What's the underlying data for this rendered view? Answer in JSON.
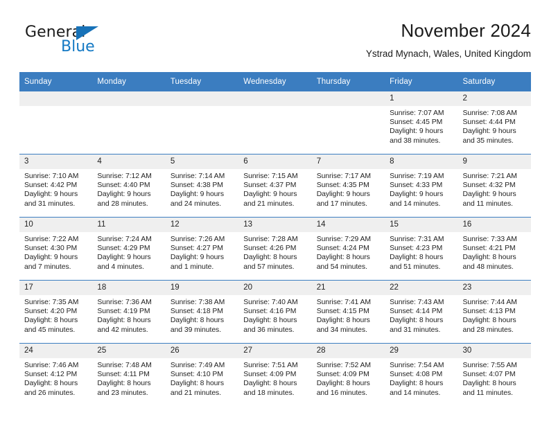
{
  "brand": {
    "name_part1": "General",
    "name_part2": "Blue",
    "accent_color": "#1479c4",
    "triangle_color": "#1772b8"
  },
  "header": {
    "title": "November 2024",
    "location": "Ystrad Mynach, Wales, United Kingdom"
  },
  "calendar": {
    "header_bg": "#3b7dc0",
    "date_band_bg": "#efefef",
    "weekdays": [
      "Sunday",
      "Monday",
      "Tuesday",
      "Wednesday",
      "Thursday",
      "Friday",
      "Saturday"
    ],
    "weeks": [
      [
        {
          "day": "",
          "empty": true,
          "lines": [
            "",
            "",
            "",
            ""
          ]
        },
        {
          "day": "",
          "empty": true,
          "lines": [
            "",
            "",
            "",
            ""
          ]
        },
        {
          "day": "",
          "empty": true,
          "lines": [
            "",
            "",
            "",
            ""
          ]
        },
        {
          "day": "",
          "empty": true,
          "lines": [
            "",
            "",
            "",
            ""
          ]
        },
        {
          "day": "",
          "empty": true,
          "lines": [
            "",
            "",
            "",
            ""
          ]
        },
        {
          "day": "1",
          "empty": false,
          "lines": [
            "Sunrise: 7:07 AM",
            "Sunset: 4:45 PM",
            "Daylight: 9 hours",
            "and 38 minutes."
          ]
        },
        {
          "day": "2",
          "empty": false,
          "lines": [
            "Sunrise: 7:08 AM",
            "Sunset: 4:44 PM",
            "Daylight: 9 hours",
            "and 35 minutes."
          ]
        }
      ],
      [
        {
          "day": "3",
          "empty": false,
          "lines": [
            "Sunrise: 7:10 AM",
            "Sunset: 4:42 PM",
            "Daylight: 9 hours",
            "and 31 minutes."
          ]
        },
        {
          "day": "4",
          "empty": false,
          "lines": [
            "Sunrise: 7:12 AM",
            "Sunset: 4:40 PM",
            "Daylight: 9 hours",
            "and 28 minutes."
          ]
        },
        {
          "day": "5",
          "empty": false,
          "lines": [
            "Sunrise: 7:14 AM",
            "Sunset: 4:38 PM",
            "Daylight: 9 hours",
            "and 24 minutes."
          ]
        },
        {
          "day": "6",
          "empty": false,
          "lines": [
            "Sunrise: 7:15 AM",
            "Sunset: 4:37 PM",
            "Daylight: 9 hours",
            "and 21 minutes."
          ]
        },
        {
          "day": "7",
          "empty": false,
          "lines": [
            "Sunrise: 7:17 AM",
            "Sunset: 4:35 PM",
            "Daylight: 9 hours",
            "and 17 minutes."
          ]
        },
        {
          "day": "8",
          "empty": false,
          "lines": [
            "Sunrise: 7:19 AM",
            "Sunset: 4:33 PM",
            "Daylight: 9 hours",
            "and 14 minutes."
          ]
        },
        {
          "day": "9",
          "empty": false,
          "lines": [
            "Sunrise: 7:21 AM",
            "Sunset: 4:32 PM",
            "Daylight: 9 hours",
            "and 11 minutes."
          ]
        }
      ],
      [
        {
          "day": "10",
          "empty": false,
          "lines": [
            "Sunrise: 7:22 AM",
            "Sunset: 4:30 PM",
            "Daylight: 9 hours",
            "and 7 minutes."
          ]
        },
        {
          "day": "11",
          "empty": false,
          "lines": [
            "Sunrise: 7:24 AM",
            "Sunset: 4:29 PM",
            "Daylight: 9 hours",
            "and 4 minutes."
          ]
        },
        {
          "day": "12",
          "empty": false,
          "lines": [
            "Sunrise: 7:26 AM",
            "Sunset: 4:27 PM",
            "Daylight: 9 hours",
            "and 1 minute."
          ]
        },
        {
          "day": "13",
          "empty": false,
          "lines": [
            "Sunrise: 7:28 AM",
            "Sunset: 4:26 PM",
            "Daylight: 8 hours",
            "and 57 minutes."
          ]
        },
        {
          "day": "14",
          "empty": false,
          "lines": [
            "Sunrise: 7:29 AM",
            "Sunset: 4:24 PM",
            "Daylight: 8 hours",
            "and 54 minutes."
          ]
        },
        {
          "day": "15",
          "empty": false,
          "lines": [
            "Sunrise: 7:31 AM",
            "Sunset: 4:23 PM",
            "Daylight: 8 hours",
            "and 51 minutes."
          ]
        },
        {
          "day": "16",
          "empty": false,
          "lines": [
            "Sunrise: 7:33 AM",
            "Sunset: 4:21 PM",
            "Daylight: 8 hours",
            "and 48 minutes."
          ]
        }
      ],
      [
        {
          "day": "17",
          "empty": false,
          "lines": [
            "Sunrise: 7:35 AM",
            "Sunset: 4:20 PM",
            "Daylight: 8 hours",
            "and 45 minutes."
          ]
        },
        {
          "day": "18",
          "empty": false,
          "lines": [
            "Sunrise: 7:36 AM",
            "Sunset: 4:19 PM",
            "Daylight: 8 hours",
            "and 42 minutes."
          ]
        },
        {
          "day": "19",
          "empty": false,
          "lines": [
            "Sunrise: 7:38 AM",
            "Sunset: 4:18 PM",
            "Daylight: 8 hours",
            "and 39 minutes."
          ]
        },
        {
          "day": "20",
          "empty": false,
          "lines": [
            "Sunrise: 7:40 AM",
            "Sunset: 4:16 PM",
            "Daylight: 8 hours",
            "and 36 minutes."
          ]
        },
        {
          "day": "21",
          "empty": false,
          "lines": [
            "Sunrise: 7:41 AM",
            "Sunset: 4:15 PM",
            "Daylight: 8 hours",
            "and 34 minutes."
          ]
        },
        {
          "day": "22",
          "empty": false,
          "lines": [
            "Sunrise: 7:43 AM",
            "Sunset: 4:14 PM",
            "Daylight: 8 hours",
            "and 31 minutes."
          ]
        },
        {
          "day": "23",
          "empty": false,
          "lines": [
            "Sunrise: 7:44 AM",
            "Sunset: 4:13 PM",
            "Daylight: 8 hours",
            "and 28 minutes."
          ]
        }
      ],
      [
        {
          "day": "24",
          "empty": false,
          "lines": [
            "Sunrise: 7:46 AM",
            "Sunset: 4:12 PM",
            "Daylight: 8 hours",
            "and 26 minutes."
          ]
        },
        {
          "day": "25",
          "empty": false,
          "lines": [
            "Sunrise: 7:48 AM",
            "Sunset: 4:11 PM",
            "Daylight: 8 hours",
            "and 23 minutes."
          ]
        },
        {
          "day": "26",
          "empty": false,
          "lines": [
            "Sunrise: 7:49 AM",
            "Sunset: 4:10 PM",
            "Daylight: 8 hours",
            "and 21 minutes."
          ]
        },
        {
          "day": "27",
          "empty": false,
          "lines": [
            "Sunrise: 7:51 AM",
            "Sunset: 4:09 PM",
            "Daylight: 8 hours",
            "and 18 minutes."
          ]
        },
        {
          "day": "28",
          "empty": false,
          "lines": [
            "Sunrise: 7:52 AM",
            "Sunset: 4:09 PM",
            "Daylight: 8 hours",
            "and 16 minutes."
          ]
        },
        {
          "day": "29",
          "empty": false,
          "lines": [
            "Sunrise: 7:54 AM",
            "Sunset: 4:08 PM",
            "Daylight: 8 hours",
            "and 14 minutes."
          ]
        },
        {
          "day": "30",
          "empty": false,
          "lines": [
            "Sunrise: 7:55 AM",
            "Sunset: 4:07 PM",
            "Daylight: 8 hours",
            "and 11 minutes."
          ]
        }
      ]
    ]
  }
}
